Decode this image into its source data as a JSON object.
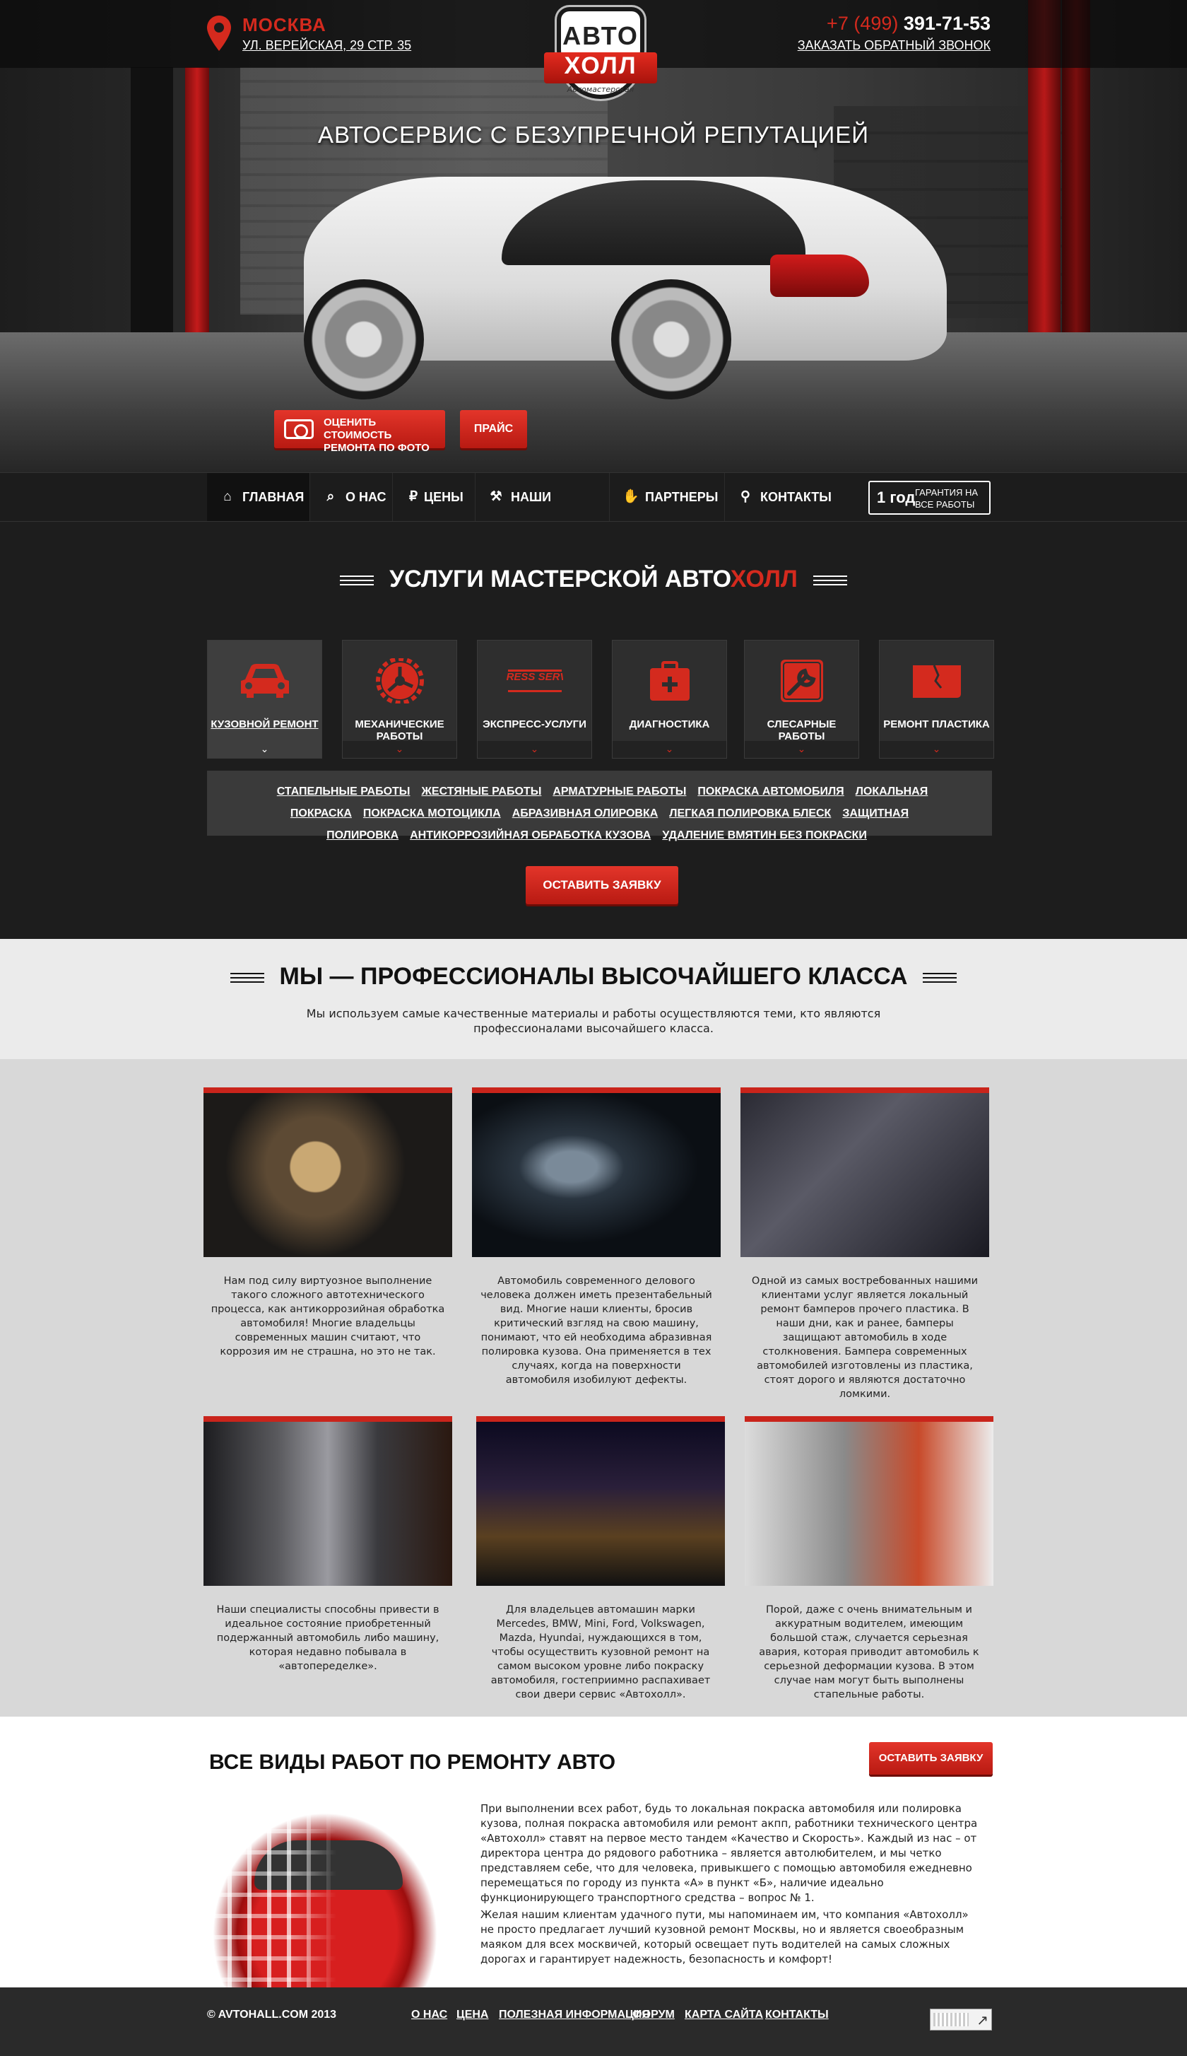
{
  "header": {
    "city": "МОСКВА",
    "address": "УЛ. ВЕРЕЙСКАЯ, 29 СТР. 35",
    "logo_top": "АВТО",
    "logo_bottom": "ХОЛЛ",
    "logo_tagline": "Автомастерская",
    "phone_code": "+7 (499)",
    "phone_number": "391-71-53",
    "callback_label": "ЗАКАЗАТЬ ОБРАТНЫЙ ЗВОНОК"
  },
  "hero": {
    "title": "АВТОСЕРВИС С БЕЗУПРЕЧНОЙ РЕПУТАЦИЕЙ",
    "estimate_button": "ОЦЕНИТЬ СТОИМОСТЬ РЕМОНТА ПО ФОТО",
    "price_button": "ПРАЙС"
  },
  "nav": {
    "items": [
      {
        "label": "ГЛАВНАЯ",
        "icon": "home-icon"
      },
      {
        "label": "О НАС",
        "icon": "search-icon"
      },
      {
        "label": "ЦЕНЫ",
        "icon": "ruble-icon"
      },
      {
        "label": "НАШИ РАБОТЫ",
        "icon": "tools-icon"
      },
      {
        "label": "ПАРТНЕРЫ",
        "icon": "handshake-icon"
      },
      {
        "label": "КОНТАКТЫ",
        "icon": "location-icon"
      }
    ],
    "guarantee_big": "1 год",
    "guarantee_small": "ГАРАНТИЯ НА ВСЕ РАБОТЫ"
  },
  "services": {
    "title_main": "УСЛУГИ МАСТЕРСКОЙ ",
    "title_auto": "АВТО",
    "title_red": "ХОЛЛ",
    "cards": [
      {
        "label": "КУЗОВНОЙ РЕМОНТ",
        "icon": "car-icon"
      },
      {
        "label": "МЕХАНИЧЕСКИЕ РАБОТЫ",
        "icon": "gear-icon"
      },
      {
        "label": "ЭКСПРЕСС-УСЛУГИ",
        "icon": "express-service-icon",
        "icon_text": "EXPRESS SERVICE"
      },
      {
        "label": "ДИАГНОСТИКА",
        "icon": "medkit-icon"
      },
      {
        "label": "СЛЕСАРНЫЕ РАБОТЫ",
        "icon": "wrench-icon"
      },
      {
        "label": "РЕМОНТ ПЛАСТИКА",
        "icon": "cracked-panel-icon"
      }
    ],
    "sublinks": [
      "СТАПЕЛЬНЫЕ РАБОТЫ",
      "ЖЕСТЯНЫЕ РАБОТЫ",
      "АРМАТУРНЫЕ РАБОТЫ",
      "ПОКРАСКА АВТОМОБИЛЯ",
      "ЛОКАЛЬНАЯ ПОКРАСКА",
      "ПОКРАСКА МОТОЦИКЛА",
      "АБРАЗИВНАЯ ОЛИРОВКА",
      "ЛЕГКАЯ ПОЛИРОВКА БЛЕСК",
      "ЗАЩИТНАЯ ПОЛИРОВКА",
      "АНТИКОРРОЗИЙНАЯ ОБРАБОТКА КУЗОВА",
      "УДАЛЕНИЕ ВМЯТИН БЕЗ ПОКРАСКИ"
    ],
    "order_button": "ОСТАВИТЬ ЗАЯВКУ"
  },
  "pros": {
    "title": "МЫ — ПРОФЕССИОНАЛЫ ВЫСОЧАЙШЕГО КЛАССА",
    "text": "Мы используем самые качественные материалы и работы осуществляются теми, кто являются профессионалами высочайшего класса."
  },
  "gallery": [
    {
      "text": "Нам под силу виртуозное выполнение такого сложного автотехнического процесса, как антикоррозийная обработка автомобиля! Многие владельцы современных машин считают, что коррозия им не страшна, но это не так."
    },
    {
      "text": "Автомобиль современного делового человека должен иметь презентабельный вид. Многие наши клиенты, бросив критический взгляд на свою машину, понимают, что ей необходима абразивная полировка кузова. Она применяется в тех случаях, когда на поверхности автомобиля изобилуют дефекты."
    },
    {
      "text": "Одной из самых востребованных нашими клиентами услуг является локальный ремонт бамперов прочего пластика. В наши дни, как и ранее, бамперы защищают автомобиль в ходе столкновения. Бампера современных автомобилей изготовлены из пластика, стоят дорого и являются достаточно ломкими."
    },
    {
      "text": "Наши специалисты способны привести в идеальное состояние приобретенный подержанный автомобиль либо машину, которая недавно побывала в «автопеределке»."
    },
    {
      "text": "Для владельцев автомашин марки Mercedes, BMW, Mini, Ford, Volkswagen, Mazda, Hyundai, нуждающихся в том, чтобы осуществить кузовной ремонт на самом высоком уровне либо покраску автомобиля, гостеприимно распахивает свои двери сервис «Автохолл»."
    },
    {
      "text": "Порой, даже с очень внимательным и аккуратным водителем, имеющим большой стаж, случается серьезная авария, которая приводит автомобиль к серьезной деформации кузова. В этом случае нам могут быть выполнены стапельные работы."
    }
  ],
  "repair": {
    "title": "ВСЕ ВИДЫ РАБОТ ПО РЕМОНТУ АВТО",
    "order_button": "ОСТАВИТЬ ЗАЯВКУ",
    "p1": "При выполнении всех работ, будь то локальная покраска автомобиля или полировка кузова, полная покраска автомобиля или ремонт акпп, работники технического центра «Автохолл» ставят на первое место тандем «Качество и Скорость». Каждый из нас – от директора центра до рядового работника – является автолюбителем, и мы четко представляем себе, что для человека, привыкшего с помощью автомобиля ежедневно перемещаться по городу из пункта «А» в пункт «Б», наличие идеально функционирующего транспортного средства – вопрос № 1.",
    "p2": "Желая нашим клиентам удачного пути, мы напоминаем им, что компания «Автохолл» не просто предлагает лучший кузовной ремонт Москвы, но и является своеобразным маяком для всех москвичей, который освещает путь водителей на самых сложных дорогах и гарантирует надежность, безопасность и комфорт!"
  },
  "footer": {
    "copyright": "© AVTOHALL.COM 2013",
    "links": [
      "О НАС",
      "ЦЕНА",
      "ПОЛЕЗНАЯ ИНФОРМАЦИЯ",
      "ФОРУМ",
      "КАРТА САЙТА",
      "КОНТАКТЫ"
    ]
  },
  "colors": {
    "accent": "#d42a1e",
    "dark": "#1d1d1d",
    "nav": "#1c1c1c"
  }
}
